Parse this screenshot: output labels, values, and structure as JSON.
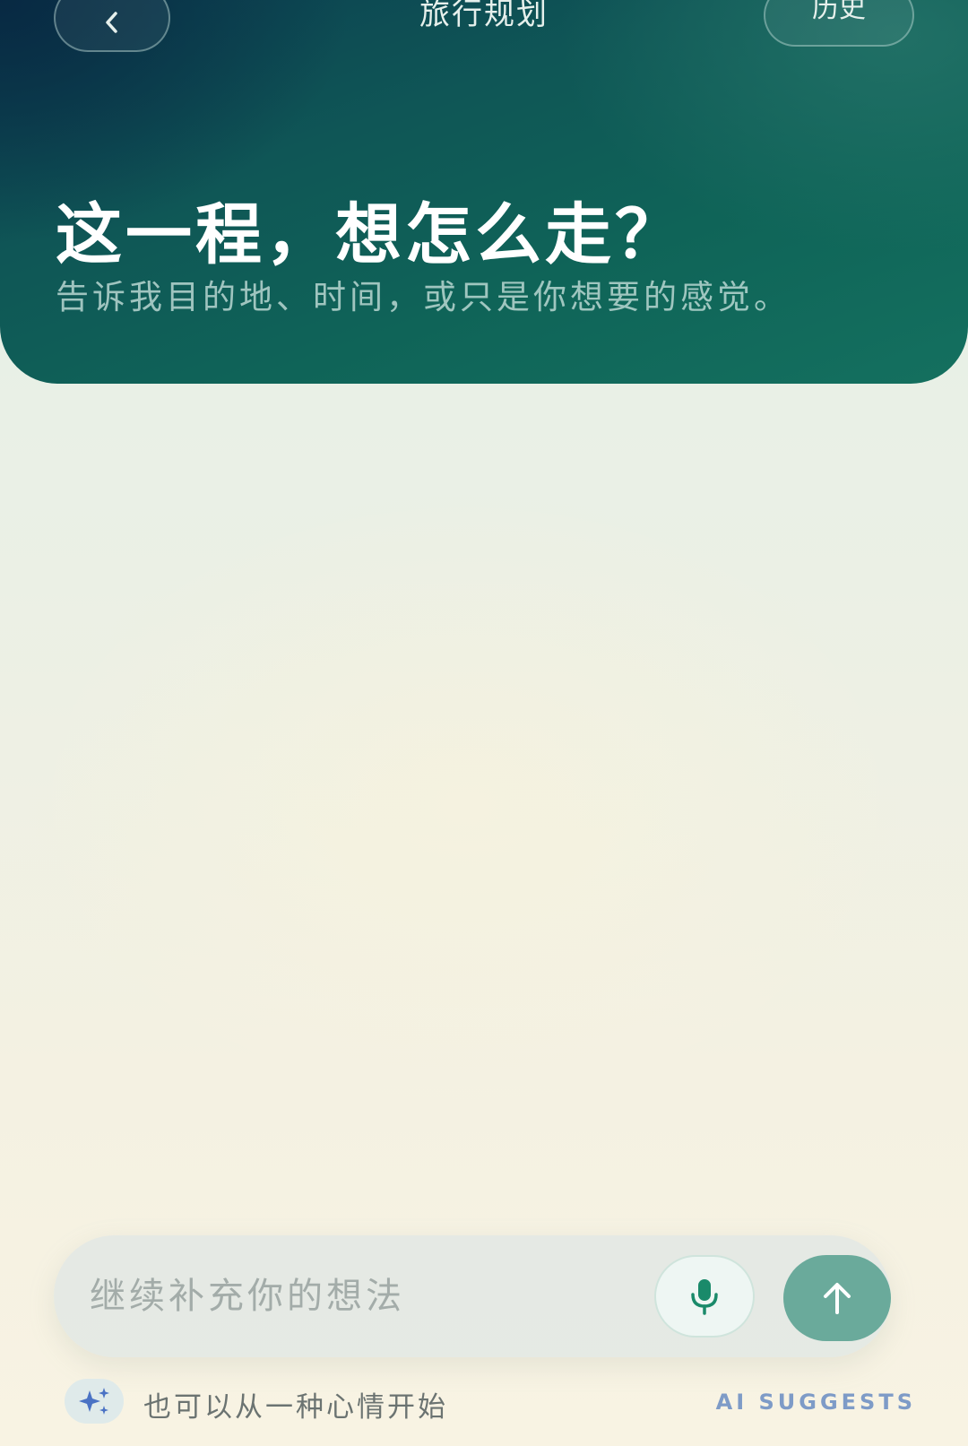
{
  "header": {
    "title": "旅行规划",
    "back_icon": "chevron-left-icon",
    "history_label": "历史"
  },
  "hero": {
    "title": "这一程，想怎么走？",
    "subtitle": "告诉我目的地、时间，或只是你想要的感觉。"
  },
  "composer": {
    "placeholder": "继续补充你的想法",
    "mic_icon": "microphone-icon",
    "send_icon": "arrow-up-icon"
  },
  "hint": {
    "icon": "sparkle-icon",
    "text": "也可以从一种心情开始",
    "badge": "AI SUGGESTS"
  },
  "colors": {
    "hero_dark": "#0b3e50",
    "hero_teal": "#14705f",
    "send_button": "#6aaa9b",
    "mic_icon": "#1a8a6a",
    "ai_label": "#7e9bc7",
    "sparkle": "#4a72c4"
  }
}
